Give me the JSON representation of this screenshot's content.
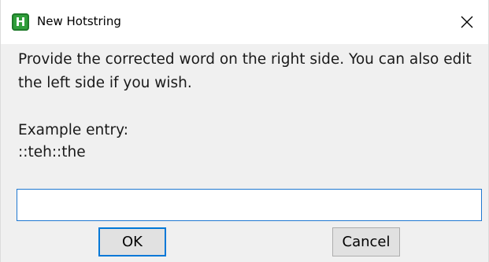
{
  "window": {
    "title": "New Hotstring",
    "app_icon_letter": "H",
    "icon_color": "#2f9e3a"
  },
  "body": {
    "description": "Provide the corrected word on the right side. You can also edit the left side if you wish.",
    "example_label": "Example entry:",
    "example_value": "::teh::the"
  },
  "input": {
    "value": "",
    "placeholder": ""
  },
  "buttons": {
    "ok_label": "OK",
    "cancel_label": "Cancel"
  },
  "colors": {
    "focus_border": "#1f78d1",
    "background": "#f0f0f0"
  }
}
